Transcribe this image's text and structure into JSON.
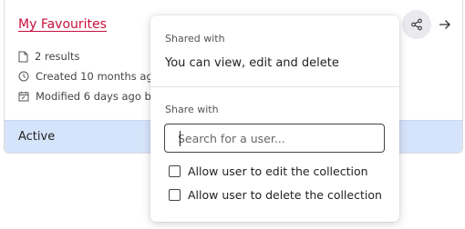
{
  "card": {
    "title": "My Favourites",
    "meta": [
      {
        "icon": "document-icon",
        "text": "2 results"
      },
      {
        "icon": "clock-icon",
        "text": "Created 10 months ago"
      },
      {
        "icon": "calendar-edit-icon",
        "text": "Modified 6 days ago by e"
      }
    ],
    "status": "Active"
  },
  "actions": {
    "share_icon": "share-icon",
    "open_icon": "arrow-right-icon"
  },
  "share_popover": {
    "shared_with_label": "Shared with",
    "permissions_text": "You can view, edit and delete",
    "share_with_label": "Share with",
    "search_placeholder": "Search for a user...",
    "search_value": "",
    "options": [
      {
        "label": "Allow user to edit the collection",
        "checked": false
      },
      {
        "label": "Allow user to delete the collection",
        "checked": false
      }
    ]
  },
  "colors": {
    "link": "#c8103d",
    "status_bar": "#d6e4fb",
    "share_button_bg": "#e9e9ee"
  }
}
